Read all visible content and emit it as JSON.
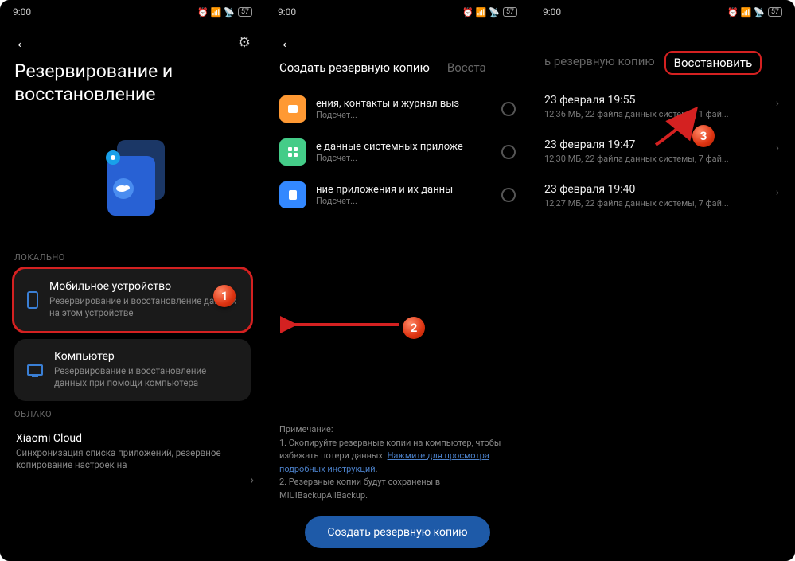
{
  "status": {
    "time": "9:00",
    "battery": "57"
  },
  "screen1": {
    "title": "Резервирование и восстановление",
    "section_local": "ЛОКАЛЬНО",
    "mobile": {
      "title": "Мобильное устройство",
      "sub": "Резервирование и восстановление данных на этом устройстве"
    },
    "computer": {
      "title": "Компьютер",
      "sub": "Резервирование и восстановление данных при помощи компьютера"
    },
    "section_cloud": "ОБЛАКО",
    "cloud": {
      "title": "Xiaomi Cloud",
      "sub": "Синхронизация списка приложений, резервное копирование настроек на"
    }
  },
  "screen2": {
    "tab_active": "Создать резервную копию",
    "tab_inactive": "Восста",
    "cat1": {
      "title": "ения, контакты и журнал выз",
      "sub": "Подсчет..."
    },
    "cat2": {
      "title": "е данные системных приложе",
      "sub": "Подсчет..."
    },
    "cat3": {
      "title": "ние приложения и их данны",
      "sub": "Подсчет..."
    },
    "note_label": "Примечание:",
    "note1a": "1. Скопируйте резервные копии на компьютер, чтобы избежать потери данных. ",
    "note1b": "Нажмите для просмотра подробных инструкций",
    "note2": "2. Резервные копии будут сохранены в MIUIBackupAllBackup.",
    "button": "Создать резервную копию"
  },
  "screen3": {
    "tab_inactive": "ь резервную копию",
    "tab_active": "Восстановить",
    "b1": {
      "date": "23 февраля 19:55",
      "info": "12,36 МБ, 22 файла данных системы, 1 фай..."
    },
    "b2": {
      "date": "23 февраля 19:47",
      "info": "12,30 МБ, 22 файла данных системы, 7 фай..."
    },
    "b3": {
      "date": "23 февраля 19:40",
      "info": "12,27 МБ, 22 файла данных системы, 7 фай..."
    }
  },
  "badges": {
    "b1": "1",
    "b2": "2",
    "b3": "3"
  }
}
